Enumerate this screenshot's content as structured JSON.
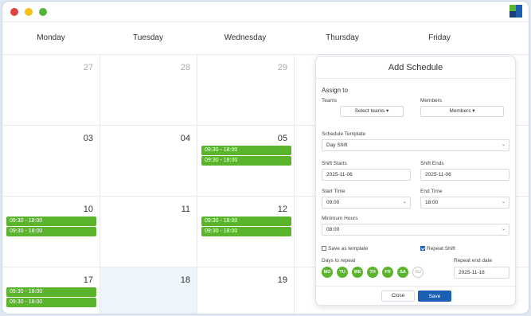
{
  "window": {
    "dots": [
      {
        "name": "close",
        "color": "#e0443e"
      },
      {
        "name": "minimize",
        "color": "#f0c21a"
      },
      {
        "name": "maximize",
        "color": "#53b33a"
      }
    ]
  },
  "calendar": {
    "days": [
      "Monday",
      "Tuesday",
      "Wednesday",
      "Thursday",
      "Friday"
    ],
    "week1": [
      "27",
      "28",
      "29"
    ],
    "week2": [
      "03",
      "04",
      "05"
    ],
    "week3": [
      "10",
      "11",
      "12"
    ],
    "week4": [
      "17",
      "18",
      "19"
    ],
    "shift_label": "09:30 - 18:00"
  },
  "modal": {
    "title": "Add Schedule",
    "assign_to": "Assign to",
    "teams_label": "Teams",
    "teams_button": "Select teams ▾",
    "members_label": "Members",
    "members_button": "Members ▾",
    "template_label": "Schedule Template",
    "template_value": "Day Shift",
    "shift_starts_label": "Shift Starts",
    "shift_starts_value": "2025-11-06",
    "shift_ends_label": "Shift Ends",
    "shift_ends_value": "2025-11-06",
    "start_time_label": "Start Time",
    "start_time_value": "09:00",
    "end_time_label": "End Time",
    "end_time_value": "18:00",
    "min_hours_label": "Minimum Hours",
    "min_hours_value": "08:00",
    "save_template_label": "Save as template",
    "save_template_checked": false,
    "repeat_shift_label": "Repeat Shift",
    "repeat_shift_checked": true,
    "days_to_repeat_label": "Days to repeat",
    "repeat_days": [
      "MO",
      "TU",
      "WE",
      "TH",
      "FR",
      "SA",
      "SU"
    ],
    "repeat_end_label": "Repeat end date",
    "repeat_end_value": "2025-11-18",
    "close_button": "Close",
    "save_button": "Save"
  },
  "colors": {
    "shift_green": "#5ab52d",
    "primary_blue": "#1a5fb4",
    "highlight_cell": "#edf4fc"
  }
}
